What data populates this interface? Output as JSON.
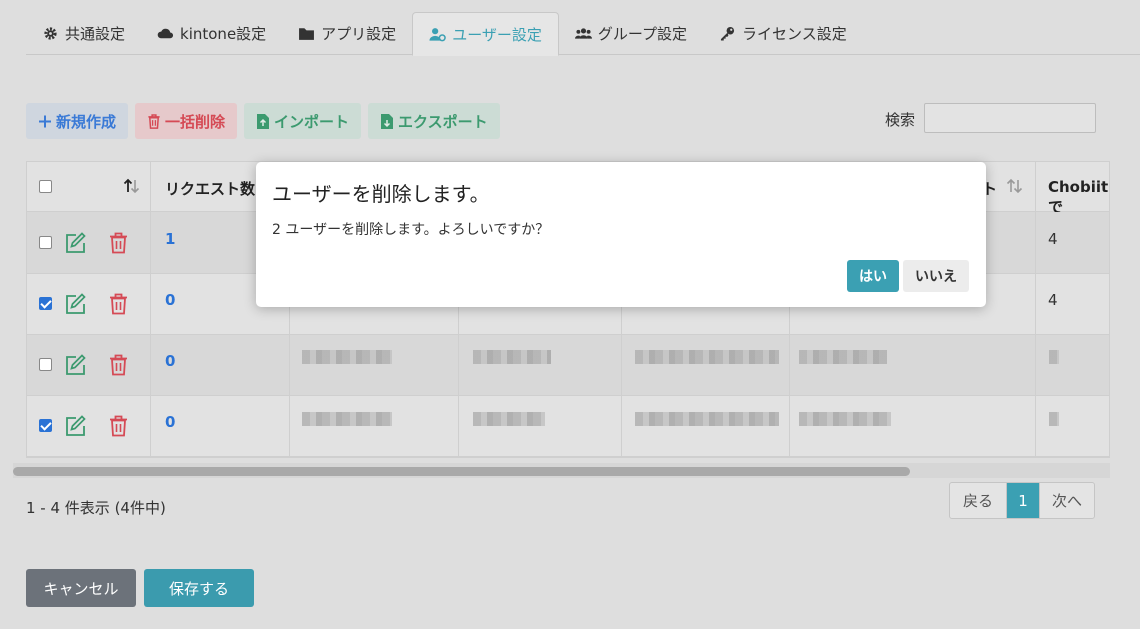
{
  "tabs": [
    {
      "label": "共通設定",
      "icon": "gear-icon"
    },
    {
      "label": "kintone設定",
      "icon": "cloud-icon"
    },
    {
      "label": "アプリ設定",
      "icon": "folder-icon"
    },
    {
      "label": "ユーザー設定",
      "icon": "user-gear-icon",
      "active": true
    },
    {
      "label": "グループ設定",
      "icon": "users-icon"
    },
    {
      "label": "ライセンス設定",
      "icon": "key-icon"
    }
  ],
  "toolbar": {
    "new_label": "新規作成",
    "bulk_delete_label": "一括削除",
    "import_label": "インポート",
    "export_label": "エクスポート",
    "search_label": "検索",
    "search_value": ""
  },
  "table": {
    "headers": [
      "リクエスト数",
      "ト",
      "Chobiitで"
    ],
    "rows": [
      {
        "checked": false,
        "count": "1",
        "last": "4"
      },
      {
        "checked": true,
        "count": "0",
        "last": "4"
      },
      {
        "checked": false,
        "count": "0",
        "last": ""
      },
      {
        "checked": true,
        "count": "0",
        "last": ""
      }
    ]
  },
  "summary": "1 - 4 件表示 (4件中)",
  "pager": {
    "prev": "戻る",
    "current": "1",
    "next": "次へ"
  },
  "footer": {
    "cancel": "キャンセル",
    "save": "保存する"
  },
  "modal": {
    "title": "ユーザーを削除します。",
    "body": "2 ユーザーを削除します。よろしいですか？",
    "yes": "はい",
    "no": "いいえ"
  },
  "colors": {
    "accent": "#3ba0b3",
    "primary_blue": "#2a72d5",
    "danger": "#d54a55",
    "success": "#3c9a6f"
  }
}
